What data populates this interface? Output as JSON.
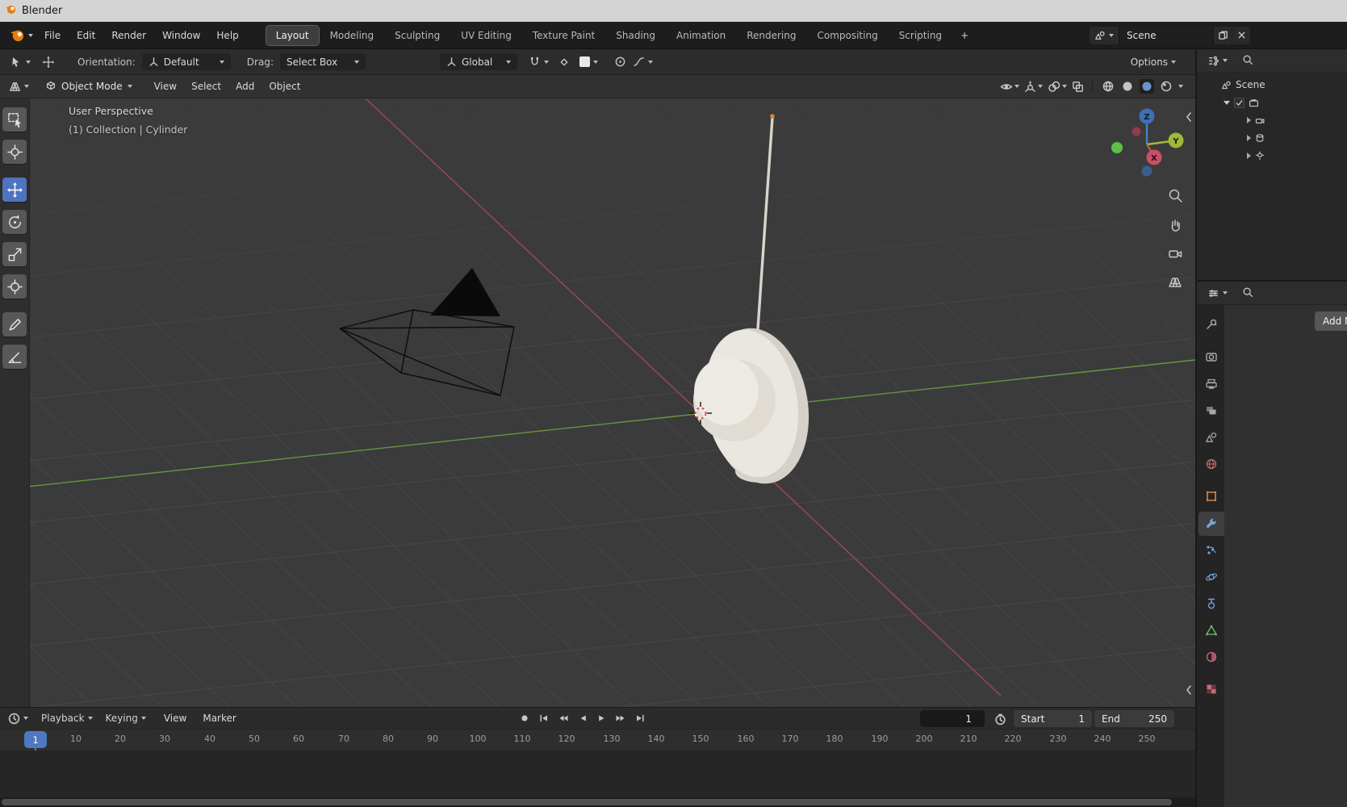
{
  "window": {
    "title": "Blender"
  },
  "menubar": {
    "menus": [
      "File",
      "Edit",
      "Render",
      "Window",
      "Help"
    ],
    "workspace_tabs": [
      "Layout",
      "Modeling",
      "Sculpting",
      "UV Editing",
      "Texture Paint",
      "Shading",
      "Animation",
      "Rendering",
      "Compositing",
      "Scripting"
    ],
    "active_workspace": "Layout",
    "new_workspace_label": "+",
    "scene_name": "Scene"
  },
  "tool_settings": {
    "orientation_label": "Orientation:",
    "orientation_value": "Default",
    "drag_label": "Drag:",
    "drag_value": "Select Box",
    "transform_orientation": "Global",
    "options_label": "Options"
  },
  "viewport_header": {
    "mode": "Object Mode",
    "menus": [
      "View",
      "Select",
      "Add",
      "Object"
    ]
  },
  "viewport": {
    "view_label": "User Perspective",
    "context_label": "(1) Collection | Cylinder",
    "gizmo_axes": {
      "x": "X",
      "y": "Y",
      "z": "Z"
    }
  },
  "outliner": {
    "scene_label": "Scene"
  },
  "properties": {
    "add_modifier_label": "Add M"
  },
  "timeline": {
    "menus": [
      "Playback",
      "Keying",
      "View",
      "Marker"
    ],
    "current_frame": "1",
    "playhead_label": "1",
    "start_label": "Start",
    "start_value": "1",
    "end_label": "End",
    "end_value": "250",
    "ruler_labels": [
      "10",
      "20",
      "30",
      "40",
      "50",
      "60",
      "70",
      "80",
      "90",
      "100",
      "110",
      "120",
      "130",
      "140",
      "150",
      "160",
      "170",
      "180",
      "190",
      "200",
      "210",
      "220",
      "230",
      "240",
      "250"
    ]
  },
  "colors": {
    "accent": "#4772b3",
    "axis_x": "#b04a5f",
    "axis_y": "#6d9e3f",
    "logo_orange": "#e87d0d"
  }
}
